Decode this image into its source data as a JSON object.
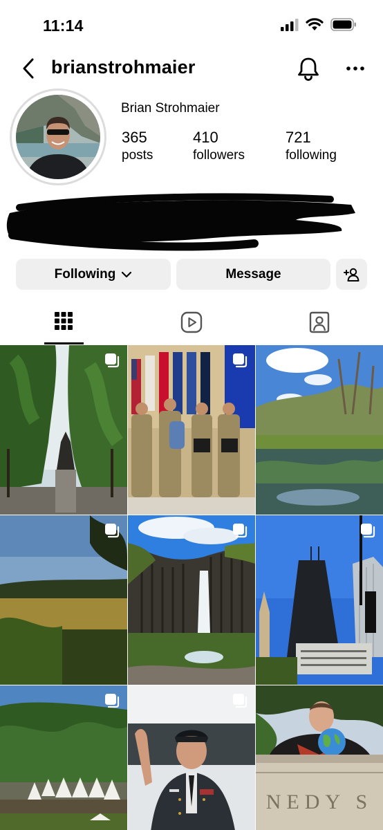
{
  "status_bar": {
    "time": "11:14",
    "icons": [
      "signal-icon",
      "wifi-icon",
      "battery-icon"
    ]
  },
  "header": {
    "username": "brianstrohmaier",
    "back_icon": "chevron-left-icon",
    "bell_icon": "bell-icon",
    "more_icon": "more-horizontal-icon"
  },
  "profile": {
    "display_name": "Brian Strohmaier",
    "stats": {
      "posts": {
        "value": "365",
        "label": "posts"
      },
      "followers": {
        "value": "410",
        "label": "followers"
      },
      "following": {
        "value": "721",
        "label": "following"
      }
    }
  },
  "actions": {
    "following_label": "Following",
    "message_label": "Message",
    "add_user_icon": "add-user-icon"
  },
  "tabs": [
    {
      "name": "posts-grid",
      "icon": "grid-icon",
      "active": true
    },
    {
      "name": "reels",
      "icon": "reels-icon",
      "active": false
    },
    {
      "name": "tagged",
      "icon": "tagged-icon",
      "active": false
    }
  ],
  "grid_posts": [
    {
      "subject": "park-statue-trees",
      "multi": true
    },
    {
      "subject": "group-uniform-flags",
      "multi": true
    },
    {
      "subject": "pond-landscape",
      "multi": false
    },
    {
      "subject": "field-sunset",
      "multi": true
    },
    {
      "subject": "waterfall-basalt",
      "multi": true
    },
    {
      "subject": "city-skyscrapers",
      "multi": true
    },
    {
      "subject": "hillside-tents",
      "multi": true
    },
    {
      "subject": "soldier-salute",
      "multi": true
    },
    {
      "subject": "man-with-globe",
      "multi": false
    }
  ],
  "grid_text": {
    "building_inscription": "NEDY S"
  },
  "colors": {
    "button_bg": "#efefef",
    "text": "#000000",
    "divider": "#dbdbdb"
  }
}
